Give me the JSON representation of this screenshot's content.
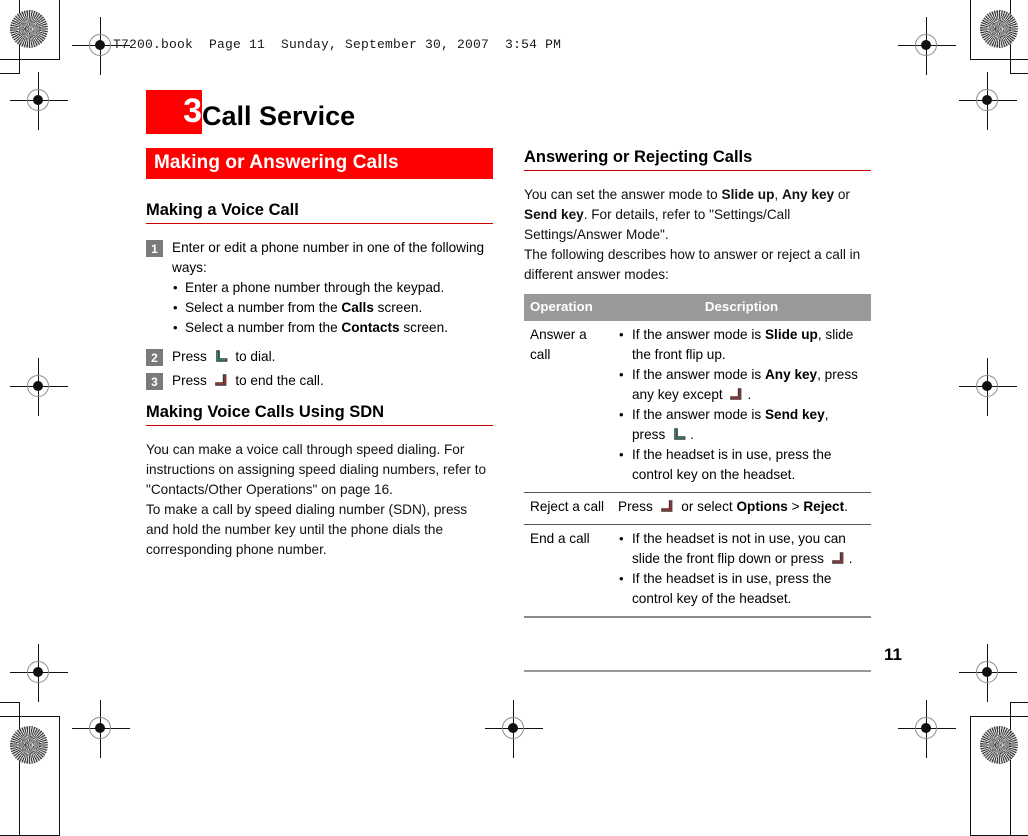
{
  "file_header": "T7200.book  Page 11  Sunday, September 30, 2007  3:54 PM",
  "chapter": {
    "number": "3",
    "title": "Call Service"
  },
  "colors": {
    "brand_red": "#ff0000",
    "rule_red": "#cc0000",
    "step_badge_gray": "#7a7a7a",
    "table_header_gray": "#9a9a9a",
    "send_key_accent": "#2f8f6a",
    "end_key_accent": "#b3322f"
  },
  "left_column": {
    "banner": "Making or Answering Calls",
    "section1": {
      "heading": "Making a Voice Call",
      "steps": [
        {
          "number": "1",
          "text": "Enter or edit a phone number in one of the following ways:",
          "bullets": [
            "Enter a phone number through the keypad.",
            "Select a number from the Calls screen.",
            "Select a number from the Contacts screen."
          ],
          "bullet_bold_terms": [
            "",
            "Calls",
            "Contacts"
          ]
        },
        {
          "number": "2",
          "text_before": "Press",
          "icon": "send-key-icon",
          "text_after": "to dial."
        },
        {
          "number": "3",
          "text_before": "Press",
          "icon": "end-key-icon",
          "text_after": "to end the call."
        }
      ]
    },
    "section2": {
      "heading": "Making Voice Calls Using SDN",
      "paragraph1": "You can make a voice call through speed dialing. For instructions on assigning speed dialing numbers, refer to \"Contacts/Other Operations\" on page 16.",
      "paragraph2": "To make a call by speed dialing number (SDN), press and hold the number key until the phone dials the corresponding phone number."
    }
  },
  "right_column": {
    "section": {
      "heading": "Answering or Rejecting Calls",
      "paragraph1_parts": {
        "a": "You can set the answer mode to ",
        "b1": "Slide up",
        "c": ", ",
        "b2": "Any key",
        "d": " or ",
        "b3": "Send key",
        "e": ". For details, refer to \"Settings/Call Settings/Answer Mode\"."
      },
      "paragraph2": "The following describes how to answer or reject a call in different answer modes:"
    },
    "table": {
      "headers": {
        "operation": "Operation",
        "description": "Description"
      },
      "rows": [
        {
          "operation": "Answer a call",
          "bullets": [
            {
              "a": "If the answer mode is ",
              "b": "Slide up",
              "c": ", slide the front flip up."
            },
            {
              "a": "If the answer mode is ",
              "b": "Any key",
              "c": ", press any key except ",
              "icon": "end-key-icon",
              "d": "."
            },
            {
              "a": "If the answer mode is ",
              "b": "Send key",
              "c": ", press ",
              "icon": "send-key-icon",
              "d": "."
            },
            {
              "a": "If the headset is in use, press the control key on the headset."
            }
          ]
        },
        {
          "operation": "Reject a call",
          "inline": {
            "a": "Press ",
            "icon": "end-key-icon",
            "b": " or select ",
            "bold1": "Options",
            "c": " > ",
            "bold2": "Reject",
            "d": "."
          }
        },
        {
          "operation": "End a call",
          "bullets": [
            {
              "a": "If the headset is not in use, you can slide the front flip down or press ",
              "icon": "end-key-icon",
              "d": "."
            },
            {
              "a": "If the headset is in use, press the control key of the headset."
            }
          ]
        }
      ]
    }
  },
  "page_number": "11"
}
